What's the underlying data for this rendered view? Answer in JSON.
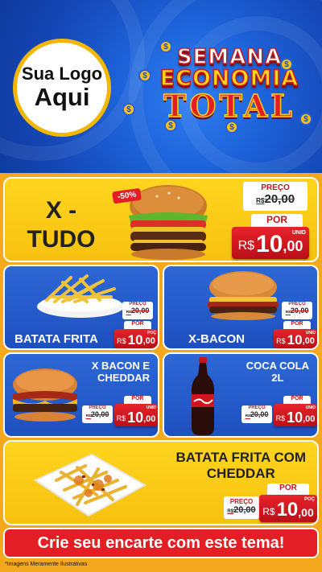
{
  "header": {
    "logo_line1": "Sua Logo",
    "logo_line2": "Aqui",
    "title_line1": "SEMANA",
    "title_line2": "ECONOMIA",
    "title_line3": "TOTAL"
  },
  "featured": {
    "name_line1": "X -",
    "name_line2": "TUDO",
    "discount": "-50%",
    "price_label": "PREÇO",
    "old_currency": "R$",
    "old_price": "20,00",
    "por_label": "POR",
    "currency": "R$",
    "price_int": "10",
    "price_dec": ",00",
    "unit": "UNID"
  },
  "products": [
    {
      "name": "BATATA FRITA",
      "price_label": "PREÇO",
      "old_currency": "R$",
      "old_price": "20,00",
      "por_label": "POR",
      "currency": "R$",
      "price_int": "10",
      "price_dec": ",00",
      "unit": "POÇ"
    },
    {
      "name": "X-BACON",
      "price_label": "PREÇO",
      "old_currency": "R$",
      "old_price": "20,00",
      "por_label": "POR",
      "currency": "R$",
      "price_int": "10",
      "price_dec": ",00",
      "unit": "UNID"
    },
    {
      "name_line1": "X BACON E",
      "name_line2": "CHEDDAR",
      "price_label": "PREÇO",
      "old_currency": "R$",
      "old_price": "20,00",
      "por_label": "POR",
      "currency": "R$",
      "price_int": "10",
      "price_dec": ",00",
      "unit": "UNID"
    },
    {
      "name_line1": "COCA COLA",
      "name_line2": "2L",
      "price_label": "PREÇO",
      "old_currency": "R$",
      "old_price": "20,00",
      "por_label": "POR",
      "currency": "R$",
      "price_int": "10",
      "price_dec": ",00",
      "unit": "UNID"
    }
  ],
  "bottom_product": {
    "name_line1": "BATATA FRITA COM",
    "name_line2": "CHEDDAR",
    "price_label": "PREÇO",
    "old_currency": "R$",
    "old_price": "20,00",
    "por_label": "POR",
    "currency": "R$",
    "price_int": "10",
    "price_dec": ",00",
    "unit": "POÇ"
  },
  "cta_text": "Crie seu encarte com este tema!",
  "footnote": "*Imagens Meramente Ilustrativas",
  "colors": {
    "brand_blue": "#1d62d8",
    "brand_yellow": "#ffd51f",
    "brand_red": "#e31e24"
  }
}
